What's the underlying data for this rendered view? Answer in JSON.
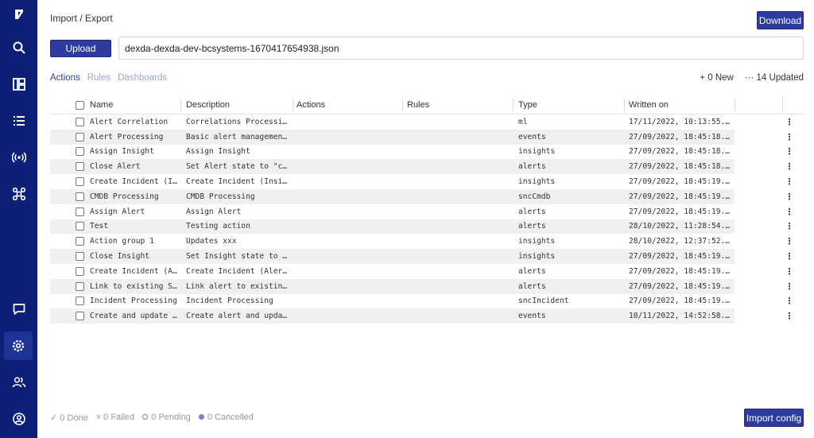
{
  "sidebar": {
    "items": [
      {
        "icon": "logo-icon"
      },
      {
        "icon": "search-icon"
      },
      {
        "icon": "dashboard-icon"
      },
      {
        "icon": "list-icon"
      },
      {
        "icon": "broadcast-icon"
      },
      {
        "icon": "integrations-icon"
      },
      {
        "icon": "chat-icon"
      },
      {
        "icon": "settings-icon",
        "active": true
      },
      {
        "icon": "users-icon"
      },
      {
        "icon": "account-icon"
      }
    ]
  },
  "header": {
    "breadcrumb": "Import / Export",
    "download_label": "Download"
  },
  "upload": {
    "button_label": "Upload",
    "filename": "dexda-dexda-dev-bcsystems-1670417654938.json"
  },
  "tabs": [
    {
      "label": "Actions",
      "active": true
    },
    {
      "label": "Rules",
      "active": false
    },
    {
      "label": "Dashboards",
      "active": false
    }
  ],
  "counts": {
    "new": "+ 0 New",
    "updated": "··· 14 Updated"
  },
  "table": {
    "columns": [
      "Name",
      "Description",
      "Actions",
      "Rules",
      "Type",
      "Written on"
    ],
    "rows": [
      {
        "name": "Alert Correlation",
        "description": "Correlations Processi…",
        "type": "ml",
        "written": "17/11/2022, 10:13:55.…"
      },
      {
        "name": "Alert Processing",
        "description": "Basic alert managemen…",
        "type": "events",
        "written": "27/09/2022, 18:45:18.…"
      },
      {
        "name": "Assign Insight",
        "description": "Assign Insight",
        "type": "insights",
        "written": "27/09/2022, 18:45:18.…"
      },
      {
        "name": "Close Alert",
        "description": "Set Alert state to \"c…",
        "type": "alerts",
        "written": "27/09/2022, 18:45:18.…"
      },
      {
        "name": "Create Incident (I…",
        "description": "Create Incident (Insi…",
        "type": "insights",
        "written": "27/09/2022, 18:45:19.…"
      },
      {
        "name": "CMDB Processing",
        "description": "CMDB Processing",
        "type": "sncCmdb",
        "written": "27/09/2022, 18:45:19.…"
      },
      {
        "name": "Assign Alert",
        "description": "Assign Alert",
        "type": "alerts",
        "written": "27/09/2022, 18:45:19.…"
      },
      {
        "name": "Test",
        "description": "Testing action",
        "type": "alerts",
        "written": "28/10/2022, 11:28:54.…"
      },
      {
        "name": "Action group 1",
        "description": "Updates xxx",
        "type": "insights",
        "written": "28/10/2022, 12:37:52.…"
      },
      {
        "name": "Close Insight",
        "description": "Set Insight state to …",
        "type": "insights",
        "written": "27/09/2022, 18:45:19.…"
      },
      {
        "name": "Create Incident (A…",
        "description": "Create Incident (Aler…",
        "type": "alerts",
        "written": "27/09/2022, 18:45:19.…"
      },
      {
        "name": "Link to existing S…",
        "description": "Link alert to existin…",
        "type": "alerts",
        "written": "27/09/2022, 18:45:19.…"
      },
      {
        "name": "Incident Processing",
        "description": "Incident Processing",
        "type": "sncIncident",
        "written": "27/09/2022, 18:45:19.…"
      },
      {
        "name": "Create and update …",
        "description": "Create alert and upda…",
        "type": "events",
        "written": "10/11/2022, 14:52:58.…"
      }
    ]
  },
  "status": {
    "done": "0 Done",
    "failed": "0 Failed",
    "pending": "0 Pending",
    "cancelled": "0 Cancelled"
  },
  "footer": {
    "import_label": "Import config"
  },
  "colors": {
    "sidebar": "#0e1f7a",
    "accent": "#2d3b9e"
  }
}
